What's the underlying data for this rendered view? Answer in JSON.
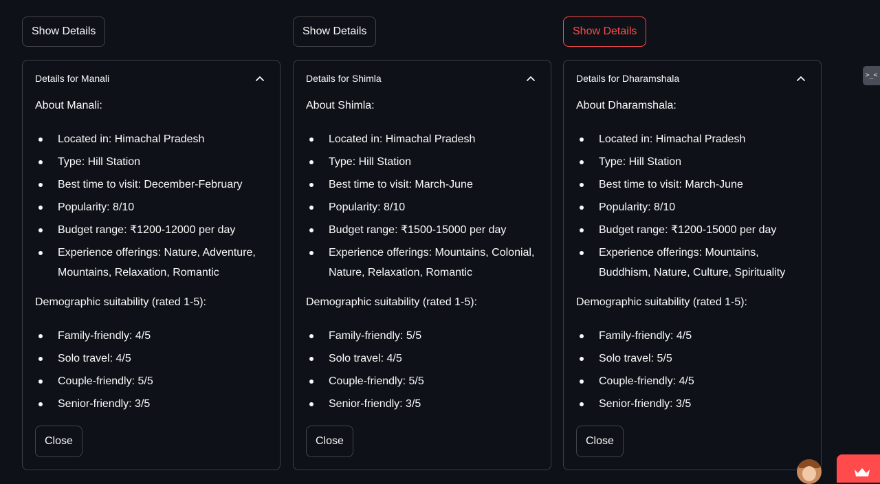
{
  "destinations": [
    {
      "show_label": "Show Details",
      "title": "Details for Manali",
      "about": "About Manali:",
      "info": [
        "Located in: Himachal Pradesh",
        "Type: Hill Station",
        "Best time to visit: December-February",
        "Popularity: 8/10",
        "Budget range: ₹1200-12000 per day",
        "Experience offerings: Nature, Adventure, Mountains, Relaxation, Romantic"
      ],
      "demographic_heading": "Demographic suitability (rated 1-5):",
      "demographics": [
        "Family-friendly: 4/5",
        "Solo travel: 4/5",
        "Couple-friendly: 5/5",
        "Senior-friendly: 3/5"
      ],
      "close_label": "Close"
    },
    {
      "show_label": "Show Details",
      "title": "Details for Shimla",
      "about": "About Shimla:",
      "info": [
        "Located in: Himachal Pradesh",
        "Type: Hill Station",
        "Best time to visit: March-June",
        "Popularity: 8/10",
        "Budget range: ₹1500-15000 per day",
        "Experience offerings: Mountains, Colonial, Nature, Relaxation, Romantic"
      ],
      "demographic_heading": "Demographic suitability (rated 1-5):",
      "demographics": [
        "Family-friendly: 5/5",
        "Solo travel: 4/5",
        "Couple-friendly: 5/5",
        "Senior-friendly: 3/5"
      ],
      "close_label": "Close"
    },
    {
      "show_label": "Show Details",
      "title": "Details for Dharamshala",
      "about": "About Dharamshala:",
      "info": [
        "Located in: Himachal Pradesh",
        "Type: Hill Station",
        "Best time to visit: March-June",
        "Popularity: 8/10",
        "Budget range: ₹1200-15000 per day",
        "Experience offerings: Mountains, Buddhism, Nature, Culture, Spirituality"
      ],
      "demographic_heading": "Demographic suitability (rated 1-5):",
      "demographics": [
        "Family-friendly: 4/5",
        "Solo travel: 5/5",
        "Couple-friendly: 4/5",
        "Senior-friendly: 3/5"
      ],
      "close_label": "Close"
    }
  ],
  "side_widget": {
    "label": ">_<"
  },
  "icons": {
    "collapse": "chevron-up-icon",
    "deploy": "crown-icon",
    "avatar": "user-avatar"
  },
  "colors": {
    "background": "#0e1117",
    "text": "#fafafa",
    "accent": "#ff4b4b",
    "border": "rgba(250,250,250,0.2)"
  }
}
